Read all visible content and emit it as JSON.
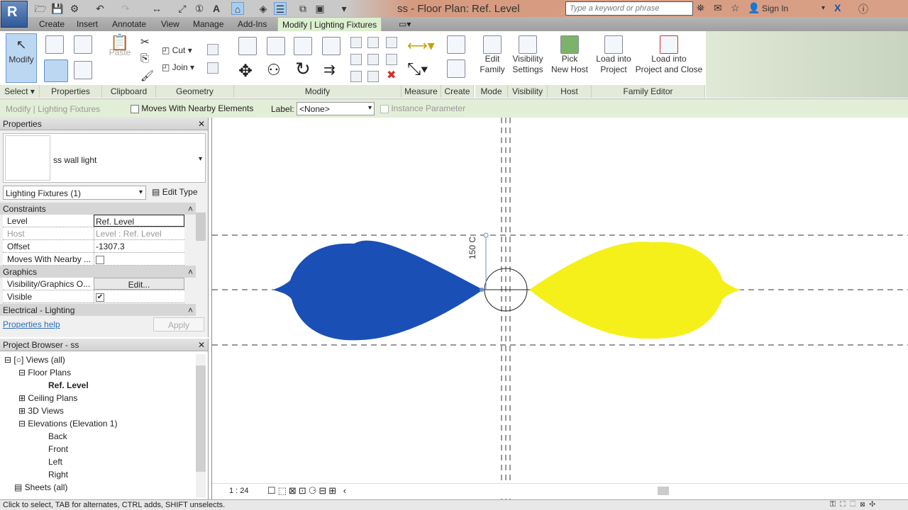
{
  "titlebar": {
    "title": "ss - Floor Plan: Ref. Level",
    "search_placeholder": "Type a keyword or phrase",
    "sign_in": "Sign In"
  },
  "tabs": [
    "Create",
    "Insert",
    "Annotate",
    "View",
    "Manage",
    "Add-Ins",
    "Modify | Lighting Fixtures"
  ],
  "ribbon": {
    "panels": [
      "Select",
      "Properties",
      "Clipboard",
      "Geometry",
      "Modify",
      "Measure",
      "Create",
      "Mode",
      "Visibility",
      "Host",
      "Family Editor"
    ],
    "modify": "Modify",
    "paste": "Paste",
    "cut": "Cut",
    "join": "Join",
    "edit_family": [
      "Edit",
      "Family"
    ],
    "visibility_settings": [
      "Visibility",
      "Settings"
    ],
    "pick_new_host": [
      "Pick",
      "New Host"
    ],
    "load_into_project": [
      "Load into",
      "Project"
    ],
    "load_into_project_close": [
      "Load into",
      "Project and Close"
    ]
  },
  "options_bar": {
    "context": "Modify | Lighting Fixtures",
    "moves_with_nearby": "Moves With Nearby Elements",
    "label_label": "Label:",
    "label_value": "<None>",
    "instance_parameter": "Instance Parameter"
  },
  "properties": {
    "title": "Properties",
    "type_name": "ss wall light",
    "filter": "Lighting Fixtures (1)",
    "edit_type": "Edit Type",
    "groups": {
      "constraints": "Constraints",
      "graphics": "Graphics",
      "electrical": "Electrical - Lighting"
    },
    "rows": [
      {
        "k": "Level",
        "v": "Ref. Level"
      },
      {
        "k": "Host",
        "v": "Level : Ref. Level"
      },
      {
        "k": "Offset",
        "v": "-1307.3"
      },
      {
        "k": "Moves With Nearby ...",
        "v": ""
      },
      {
        "k": "Visibility/Graphics O...",
        "v": "Edit..."
      },
      {
        "k": "Visible",
        "v": "✔"
      }
    ],
    "help": "Properties help",
    "apply": "Apply"
  },
  "browser": {
    "title": "Project Browser - ss",
    "items": [
      "Views (all)",
      "Floor Plans",
      "Ref. Level",
      "Ceiling Plans",
      "3D Views",
      "Elevations (Elevation 1)",
      "Back",
      "Front",
      "Left",
      "Right",
      "Sheets (all)"
    ]
  },
  "canvas": {
    "dimension": "150 C",
    "scale": "1 : 24",
    "colors": {
      "left": "#1a4fb5",
      "right": "#f5f01a"
    }
  },
  "status": {
    "text": "Click to select, TAB for alternates, CTRL adds, SHIFT unselects."
  }
}
